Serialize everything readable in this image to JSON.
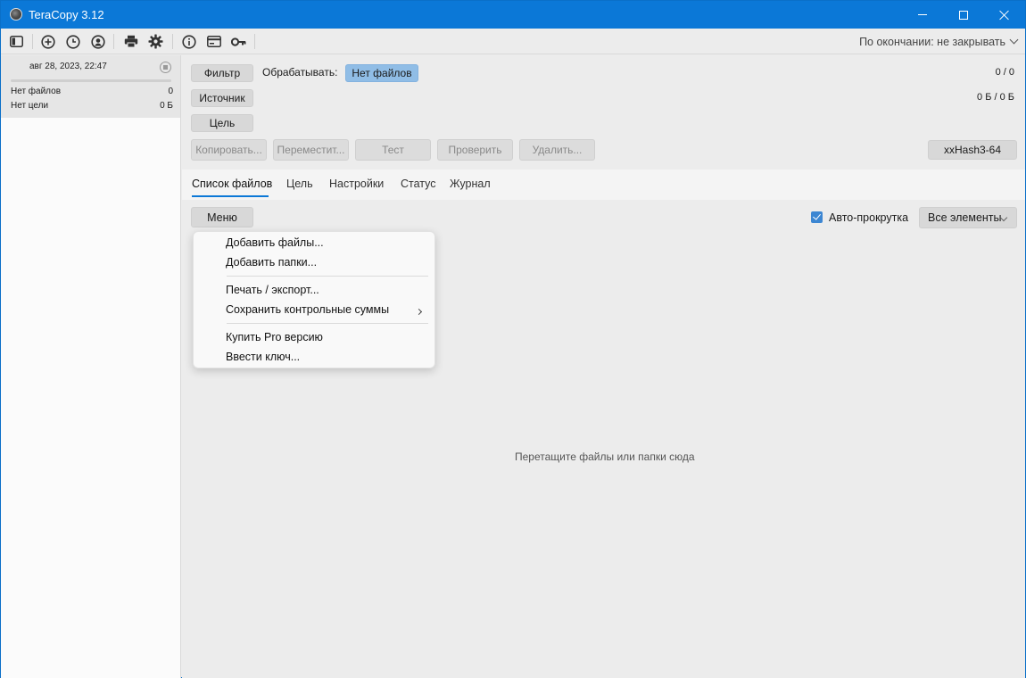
{
  "window": {
    "title": "TeraCopy 3.12"
  },
  "toolbar": {
    "icons": [
      "sidebar-toggle-icon",
      "add-icon",
      "history-icon",
      "profile-icon",
      "print-icon",
      "settings-icon",
      "info-icon",
      "card-icon",
      "key-icon"
    ],
    "after_completion": "По окончании: не закрывать"
  },
  "job": {
    "date": "авг 28, 2023, 22:47",
    "progress": 0,
    "rows": [
      {
        "label": "Нет файлов",
        "value": "0"
      },
      {
        "label": "Нет цели",
        "value": "0 Б"
      }
    ]
  },
  "controls": {
    "filter": "Фильтр",
    "process_label": "Обрабатывать:",
    "process_value": "Нет файлов",
    "source": "Источник",
    "target": "Цель",
    "count": "0 / 0",
    "size": "0 Б / 0 Б"
  },
  "actions": {
    "copy": "Копировать...",
    "move": "Переместит...",
    "test": "Тест",
    "verify": "Проверить",
    "delete": "Удалить...",
    "hash": "xxHash3-64"
  },
  "tabs": [
    "Список файлов",
    "Цель",
    "Настройки",
    "Статус",
    "Журнал"
  ],
  "list": {
    "menu_button": "Меню",
    "autoscroll_label": "Авто-прокрутка",
    "autoscroll_checked": true,
    "filter_select": "Все элементы",
    "empty_hint": "Перетащите файлы или папки сюда"
  },
  "popup_menu": {
    "items": [
      "Добавить файлы...",
      "Добавить папки...",
      "Печать / экспорт...",
      "Сохранить контрольные суммы",
      "Купить Pro версию",
      "Ввести ключ..."
    ]
  },
  "colors": {
    "titlebar": "#0b78d7",
    "accent": "#90bde6",
    "checkbox": "#3c86d2"
  }
}
